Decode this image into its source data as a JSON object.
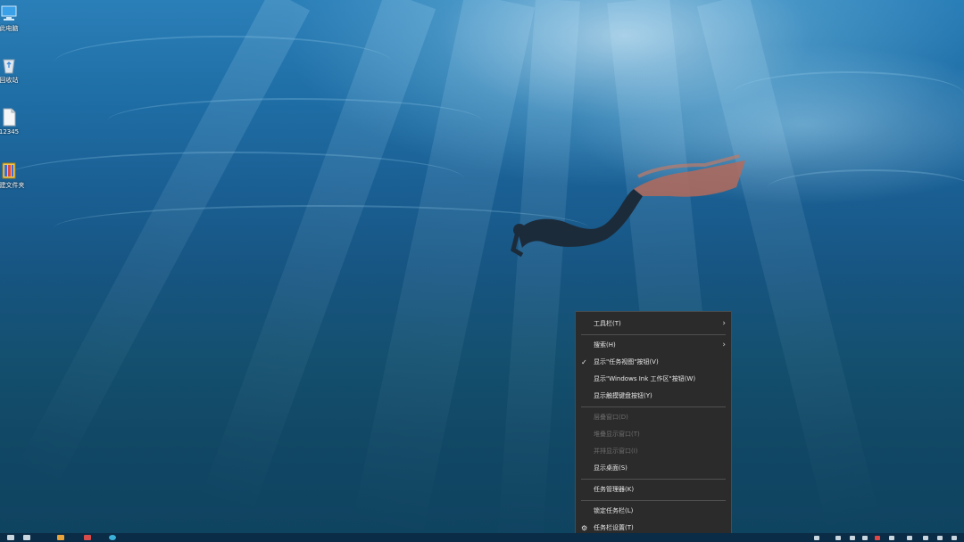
{
  "desktop": {
    "icons": [
      {
        "label": "此电脑",
        "icon": "computer-icon"
      },
      {
        "label": "回收站",
        "icon": "recycle-bin-icon"
      },
      {
        "label": "12345",
        "icon": "file-icon"
      },
      {
        "label": "新建文件夹",
        "icon": "archive-icon"
      }
    ],
    "wallpaper": "underwater-swimmer"
  },
  "context_menu": {
    "items": [
      {
        "label": "工具栏(T)",
        "submenu": true
      },
      {
        "label": "搜索(H)",
        "submenu": true
      },
      {
        "label": "显示\"任务视图\"按钮(V)",
        "checked": true
      },
      {
        "label": "显示\"Windows Ink 工作区\"按钮(W)"
      },
      {
        "label": "显示触摸键盘按钮(Y)"
      },
      {
        "label": "层叠窗口(D)",
        "disabled": true
      },
      {
        "label": "堆叠显示窗口(T)",
        "disabled": true
      },
      {
        "label": "并排显示窗口(I)",
        "disabled": true
      },
      {
        "label": "显示桌面(S)"
      },
      {
        "label": "任务管理器(K)"
      },
      {
        "label": "锁定任务栏(L)"
      },
      {
        "label": "任务栏设置(T)",
        "selected_icon": "gear-icon"
      }
    ],
    "check_mark": "✓",
    "arrow": "›",
    "gear_glyph": "⚙"
  },
  "taskbar": {
    "color": "#0b2c46"
  }
}
